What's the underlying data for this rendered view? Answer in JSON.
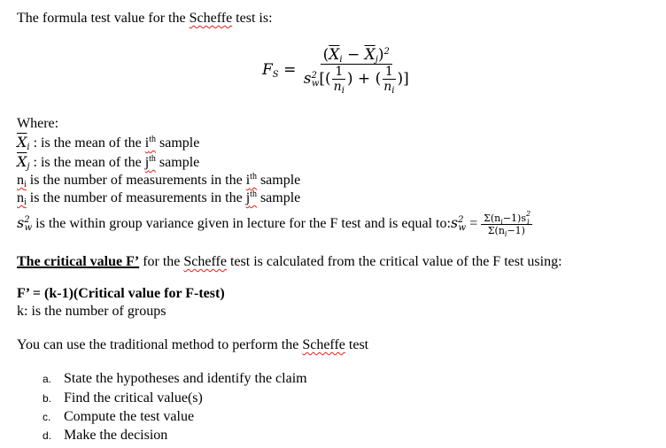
{
  "intro": {
    "text_before": "The formula test value for the ",
    "scheffe": "Scheffe",
    "text_after": " test is:"
  },
  "formula": {
    "lhs_symbol": "F",
    "lhs_sub": "S",
    "equals": "=",
    "numerator_open": "(",
    "xi": "X",
    "xi_sub": "i",
    "minus": " − ",
    "xj": "X",
    "xj_sub": "j",
    "numerator_close": ")",
    "numerator_power": "2",
    "den_s": "s",
    "den_sup": "2",
    "den_sub": "w",
    "den_open": "[(",
    "one": "1",
    "ni": "n",
    "ni_sub": "i",
    "den_mid": ") + (",
    "den_close": ")]"
  },
  "where": {
    "heading": "Where:",
    "items": [
      {
        "symbol": "X",
        "sub": "i",
        "text_a": " : is the mean of the ",
        "ord": "i",
        "ord_sup": "th",
        "text_b": " sample"
      },
      {
        "symbol": "X",
        "sub": "j",
        "text_a": " : is the mean of the ",
        "ord": "j",
        "ord_sup": "th",
        "text_b": " sample"
      },
      {
        "symbol": "n",
        "sub": "i",
        "text_a": " is the number of measurements in the ",
        "ord": "i",
        "ord_sup": "th",
        "text_b": " sample"
      },
      {
        "symbol": "n",
        "sub": "i",
        "text_a": " is the number of measurements in the ",
        "ord": "j",
        "ord_sup": "th",
        "text_b": " sample"
      }
    ],
    "variance": {
      "s": "s",
      "sup": "2",
      "sub": "w",
      "text": " is the within group variance given in lecture for the F test and is equal to:",
      "eq": " = ",
      "num": "Σ(n",
      "num_sub": "i",
      "num_rest": "−1)s",
      "num_s_sup": "2",
      "num_s_sub": "i",
      "den": "Σ(n",
      "den_sub": "i",
      "den_rest": "−1)"
    }
  },
  "critical": {
    "bold_label": "The critical value F’",
    "text_a": " for the ",
    "scheffe": "Scheffe",
    "text_b": " test is calculated from the critical value of the F test using:",
    "formula_bold": "F’ = (k-1)(Critical value for F-test)",
    "k_def": "k: is the number of groups"
  },
  "method": {
    "text_a": "You can use the traditional method to perform the ",
    "scheffe": "Scheffe",
    "text_b": " test"
  },
  "steps": [
    {
      "marker": "a.",
      "text": "State the hypotheses and identify the claim"
    },
    {
      "marker": "b.",
      "text": "Find the critical value(s)"
    },
    {
      "marker": "c.",
      "text": "Compute the test value"
    },
    {
      "marker": "d.",
      "text": "Make the decision"
    }
  ]
}
